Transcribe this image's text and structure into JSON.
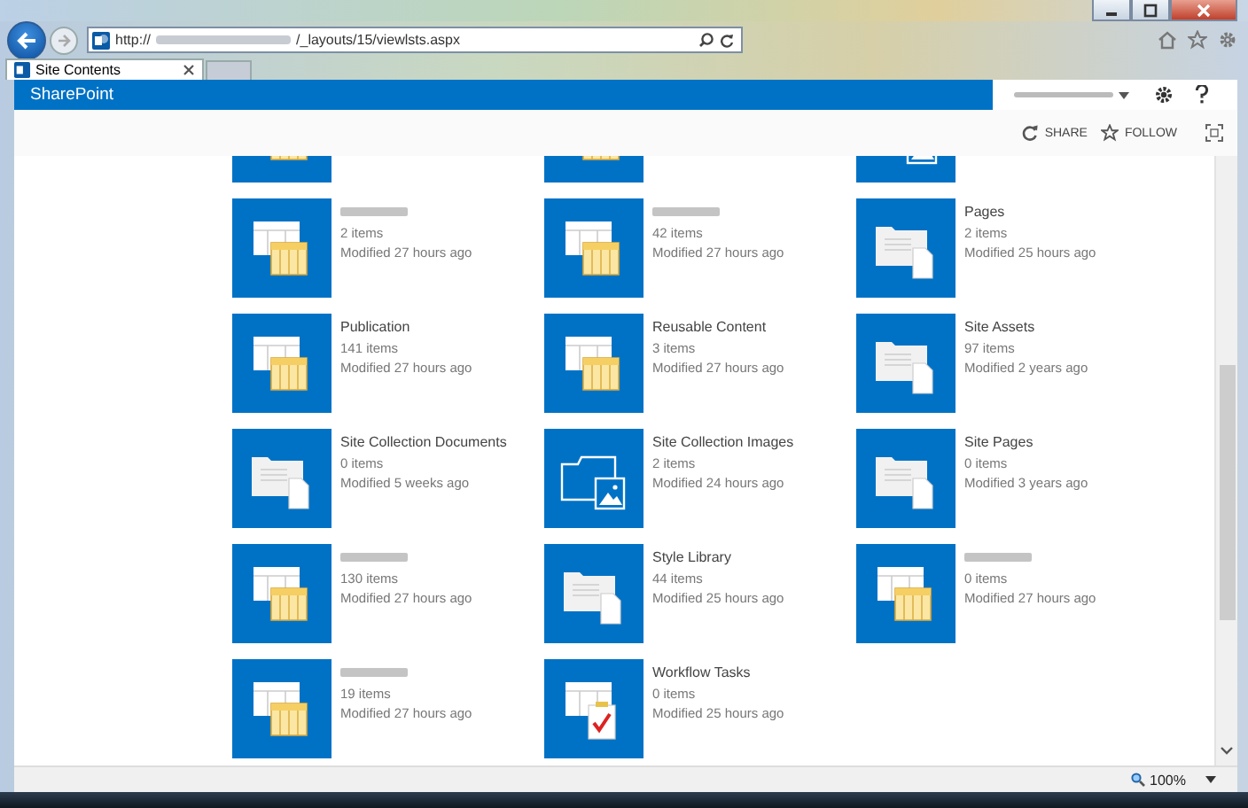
{
  "browser": {
    "url_prefix": "http://",
    "url_suffix": "/_layouts/15/viewlsts.aspx",
    "tab": {
      "title": "Site Contents"
    }
  },
  "suite_bar": {
    "brand": "SharePoint"
  },
  "actions": [
    {
      "label": "SHARE",
      "kind": "share"
    },
    {
      "label": "FOLLOW",
      "kind": "follow"
    }
  ],
  "tiles": [
    {
      "kind": "list",
      "cut": true
    },
    {
      "kind": "list",
      "cut": true
    },
    {
      "kind": "images",
      "cut": true
    },
    {
      "kind": "list",
      "redacted": true,
      "count": "2 items",
      "modified": "Modified 27 hours ago"
    },
    {
      "kind": "list",
      "redacted": true,
      "count": "42 items",
      "modified": "Modified 27 hours ago"
    },
    {
      "kind": "library",
      "title": "Pages",
      "count": "2 items",
      "modified": "Modified 25 hours ago"
    },
    {
      "kind": "list",
      "title": "Publication",
      "count": "141 items",
      "modified": "Modified 27 hours ago"
    },
    {
      "kind": "list",
      "title": "Reusable Content",
      "count": "3 items",
      "modified": "Modified 27 hours ago"
    },
    {
      "kind": "library",
      "title": "Site Assets",
      "count": "97 items",
      "modified": "Modified 2 years ago"
    },
    {
      "kind": "library",
      "title": "Site Collection Documents",
      "count": "0 items",
      "modified": "Modified 5 weeks ago"
    },
    {
      "kind": "images",
      "title": "Site Collection Images",
      "count": "2 items",
      "modified": "Modified 24 hours ago"
    },
    {
      "kind": "library",
      "title": "Site Pages",
      "count": "0 items",
      "modified": "Modified 3 years ago"
    },
    {
      "kind": "list",
      "redacted": true,
      "count": "130 items",
      "modified": "Modified 27 hours ago"
    },
    {
      "kind": "library",
      "title": "Style Library",
      "count": "44 items",
      "modified": "Modified 25 hours ago"
    },
    {
      "kind": "list",
      "redacted": true,
      "count": "0 items",
      "modified": "Modified 27 hours ago"
    },
    {
      "kind": "list",
      "redacted": true,
      "count": "19 items",
      "modified": "Modified 27 hours ago"
    },
    {
      "kind": "tasks",
      "title": "Workflow Tasks",
      "count": "0 items",
      "modified": "Modified 25 hours ago"
    }
  ],
  "status_bar": {
    "zoom": "100%"
  }
}
